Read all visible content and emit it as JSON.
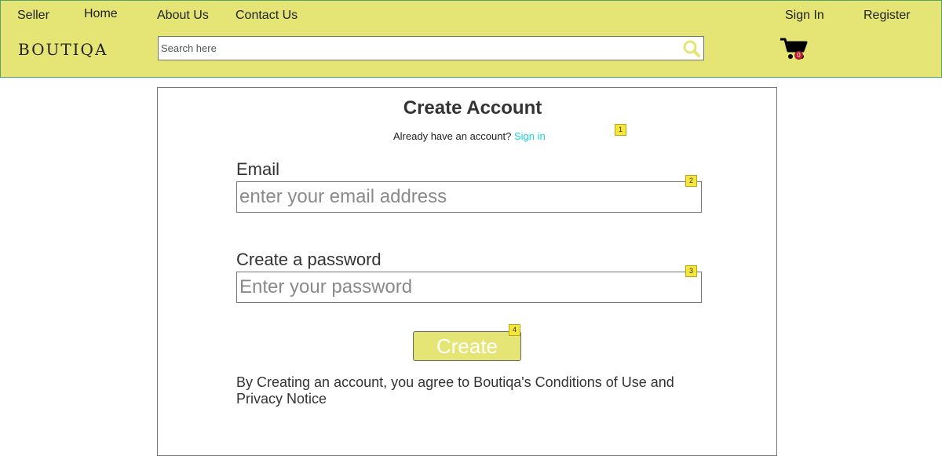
{
  "header": {
    "nav": {
      "seller": "Seller",
      "home": "Home",
      "about": "About Us",
      "contact": "Contact Us",
      "sign_in": "Sign In",
      "register": "Register"
    },
    "logo": "BOUTIQA",
    "search": {
      "placeholder": "Search here",
      "value": ""
    },
    "cart": {
      "count": "0"
    },
    "colors": {
      "header_bg": "#e4e574",
      "search_icon": "#e4e574",
      "cart_badge": "#b61e2e"
    }
  },
  "form": {
    "title": "Create Account",
    "already_text": "Already have an account?",
    "sign_in_link": "Sign in",
    "email": {
      "label": "Email",
      "placeholder": "enter your email address",
      "value": ""
    },
    "password": {
      "label": "Create a password",
      "placeholder": "Enter your password",
      "value": ""
    },
    "create_button": "Create",
    "terms": "By Creating an account, you agree to Boutiqa's Conditions of Use and Privacy Notice",
    "colors": {
      "link": "#19d3dd",
      "button_bg": "#e4e574"
    }
  },
  "markers": [
    "1",
    "2",
    "3",
    "4"
  ]
}
